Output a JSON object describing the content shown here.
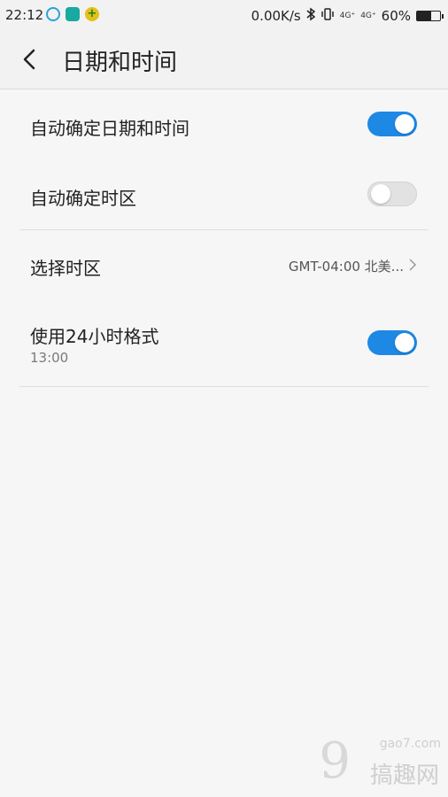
{
  "status_bar": {
    "time": "22:12",
    "net_speed": "0.00K/s",
    "signal_1": "4G⁺",
    "signal_2": "4G⁺",
    "battery_text": "60%",
    "battery_level": 0.6,
    "left_icons": [
      {
        "name": "headset-icon",
        "color": "#2aa3d8"
      },
      {
        "name": "scan-icon",
        "color": "#19a9a0"
      },
      {
        "name": "plus-icon",
        "color": "#e1c21b"
      }
    ]
  },
  "header": {
    "title": "日期和时间"
  },
  "settings": {
    "auto_datetime": {
      "label": "自动确定日期和时间",
      "enabled": true
    },
    "auto_timezone": {
      "label": "自动确定时区",
      "enabled": false
    },
    "select_timezone": {
      "label": "选择时区",
      "value": "GMT-04:00 北美..."
    },
    "use_24h": {
      "label": "使用24小时格式",
      "sub": "13:00",
      "enabled": true
    }
  },
  "watermark": {
    "site": "gao7.com",
    "text": "搞趣网"
  },
  "colors": {
    "accent": "#1e88e5",
    "toggle_off": "#e2e2e2"
  }
}
